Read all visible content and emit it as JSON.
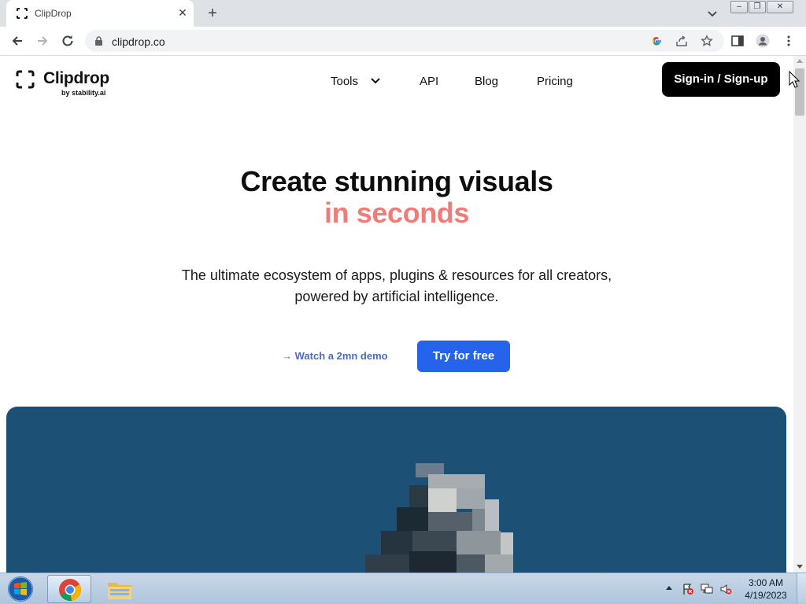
{
  "browser": {
    "tab_title": "ClipDrop",
    "tab_close_glyph": "✕",
    "new_tab_glyph": "+",
    "url": "clipdrop.co",
    "window_buttons": [
      "‒",
      "❐",
      "✕"
    ]
  },
  "site": {
    "logo_text": "Clipdrop",
    "logo_sub": "by stability.ai",
    "nav": {
      "tools": "Tools",
      "api": "API",
      "blog": "Blog",
      "pricing": "Pricing"
    },
    "signin_label": "Sign-in / Sign-up"
  },
  "hero": {
    "title": "Create stunning visuals",
    "title_accent": "in seconds",
    "subtitle_line1": "The ultimate ecosystem of apps, plugins & resources for all creators,",
    "subtitle_line2": "powered by artificial intelligence.",
    "demo_link": "→ Watch a 2mn demo",
    "cta": "Try for free"
  },
  "colors": {
    "accent_pink": "#ef7c78",
    "cta_blue": "#2563eb",
    "showcase_bg": "#1c5075"
  },
  "taskbar": {
    "time": "3:00 AM",
    "date": "4/19/2023",
    "apps": [
      "windows-start-icon",
      "chrome-icon",
      "file-explorer-icon"
    ]
  }
}
